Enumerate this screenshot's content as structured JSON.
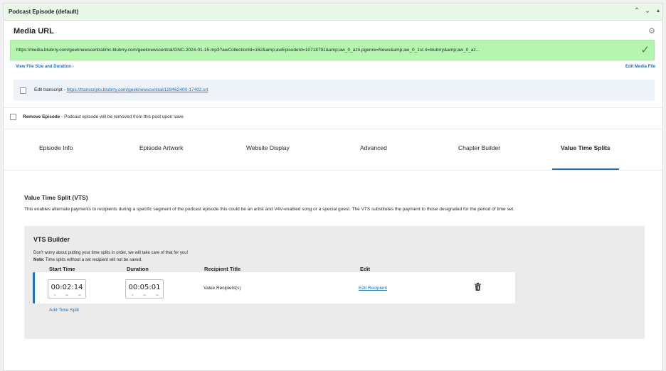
{
  "metabox": {
    "title": "Podcast Episode (default)",
    "up_icon": "chevron-up-icon",
    "down_icon": "chevron-down-icon",
    "toggle_icon": "caret-up-icon"
  },
  "media": {
    "title": "Media URL",
    "url": "https://media.blubrry.com/geeknewscentral/mc.blubrry.com/geeknewscentral/GNC-2024-01-15.mp3?awCollectionId=162&amp;awEpisodeId=10718791&amp;aw_0_azn.pgenre=News&amp;aw_0_1st.ri=blubrry&amp;aw_0_az...",
    "view_file_size": "View File Size and Duration",
    "edit_media_file": "Edit Media File",
    "accent": "#b5f5b0"
  },
  "transcript": {
    "prefix": "Edit transcript - ",
    "link": "https://transcripts.blubrry.com/geeknewscentral/128462400-17402.srt"
  },
  "remove": {
    "label": "Remove Episode",
    "note": " - Podcast episode will be removed from this post upon save"
  },
  "tabs": [
    {
      "label": "Episode Info"
    },
    {
      "label": "Episode Artwork"
    },
    {
      "label": "Website Display"
    },
    {
      "label": "Advanced"
    },
    {
      "label": "Chapter Builder"
    },
    {
      "label": "Value Time Splits",
      "active": true
    }
  ],
  "vts": {
    "title": "Value Time Split (VTS)",
    "description": "This enables alternate payments to recipients during a specific segment of the podcast episode this could be an artist and V4V-enabled song or a special guest. The VTS substitutes the payment to those designated for the period of time set.",
    "builder": {
      "title": "VTS Builder",
      "note1": "Don't worry about putting your time splits in order, we will take care of that for you!",
      "note2_bold": "Note:",
      "note2": " Time splits without a set recipient will not be saved.",
      "columns": {
        "start": "Start Time",
        "duration": "Duration",
        "recipient": "Recipient Title",
        "edit": "Edit"
      },
      "rows": [
        {
          "start": "00:02:14",
          "duration": "00:05:01",
          "recipient": "Value Recipient(s)",
          "edit": "Edit Recipient"
        }
      ],
      "time_units": {
        "hr": "hr",
        "min": "min",
        "sec": "sec"
      },
      "add_split": "Add Time Split"
    }
  }
}
